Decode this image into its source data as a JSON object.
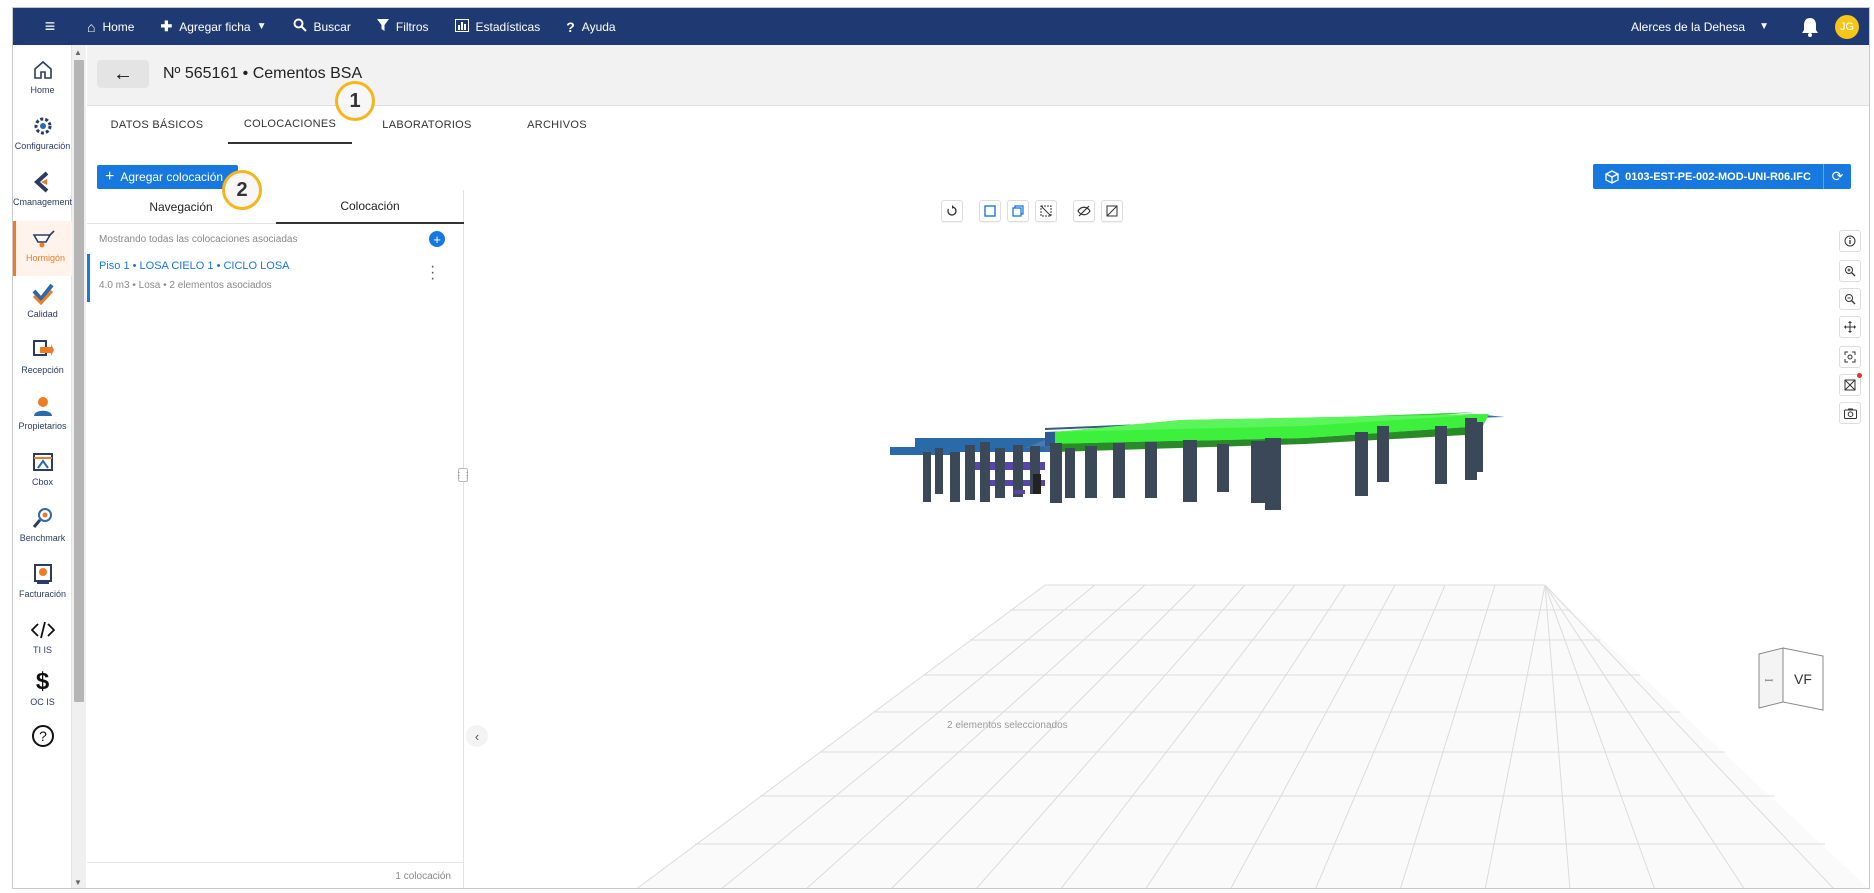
{
  "topbar": {
    "nav": [
      {
        "icon": "home-icon",
        "label": "Home"
      },
      {
        "icon": "plus-icon",
        "label": "Agregar ficha"
      },
      {
        "icon": "search-icon",
        "label": "Buscar"
      },
      {
        "icon": "filter-icon",
        "label": "Filtros"
      },
      {
        "icon": "chart-icon",
        "label": "Estadísticas"
      },
      {
        "icon": "help-icon",
        "label": "Ayuda"
      }
    ],
    "project": "Alerces de la Dehesa",
    "avatar_initials": "JG"
  },
  "sidebar": {
    "items": [
      {
        "label": "Home",
        "icon": "home-icon"
      },
      {
        "label": "Configuración",
        "icon": "settings-icon"
      },
      {
        "label": "Cmanagement",
        "icon": "cmanagement-icon"
      },
      {
        "label": "Hormigón",
        "icon": "wheelbarrow-icon",
        "active": true
      },
      {
        "label": "Calidad",
        "icon": "quality-icon"
      },
      {
        "label": "Recepción",
        "icon": "reception-icon"
      },
      {
        "label": "Propietarios",
        "icon": "owner-icon"
      },
      {
        "label": "Cbox",
        "icon": "cbox-icon"
      },
      {
        "label": "Benchmark",
        "icon": "benchmark-icon"
      },
      {
        "label": "Facturación",
        "icon": "billing-icon"
      },
      {
        "label": "TI IS",
        "icon": "code-icon"
      },
      {
        "label": "OC IS",
        "icon": "dollar-icon"
      }
    ]
  },
  "header": {
    "back_arrow": "←",
    "title": "Nº 565161 • Cementos BSA"
  },
  "tabs": [
    {
      "label": "DATOS BÁSICOS",
      "active": false
    },
    {
      "label": "COLOCACIONES",
      "active": true
    },
    {
      "label": "LABORATORIOS",
      "active": false
    },
    {
      "label": "ARCHIVOS",
      "active": false
    }
  ],
  "actions": {
    "add_label": "Agregar colocación",
    "model_label": "0103-EST-PE-002-MOD-UNI-R06.IFC"
  },
  "left_panel": {
    "subtabs": [
      {
        "label": "Navegación",
        "active": false
      },
      {
        "label": "Colocación",
        "active": true
      }
    ],
    "showing_text": "Mostrando todas las colocaciones asociadas",
    "placement": {
      "name": "Piso 1 • LOSA CIELO 1 • CICLO LOSA",
      "meta": "4.0 m3 • Losa • 2 elementos asociados"
    },
    "count": "1 colocación"
  },
  "viewer": {
    "toolbar": [
      "reset-icon",
      "select-box-icon",
      "select-multi-icon",
      "section-icon",
      "hide-icon",
      "isolate-icon"
    ],
    "right_tools": [
      "info-icon",
      "zoom-in-icon",
      "zoom-out-icon",
      "pan-icon",
      "fit-icon",
      "clip-icon",
      "camera-icon"
    ],
    "selected_text": "2 elementos seleccionados",
    "viewcube_label": "VF",
    "colors": {
      "slab": "#3cf03c",
      "structure": "#3a4858",
      "beams": "#2a6aa8"
    }
  },
  "callouts": [
    "1",
    "2"
  ]
}
